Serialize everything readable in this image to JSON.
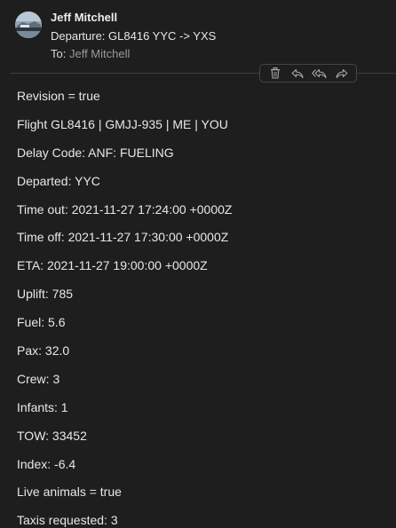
{
  "message": {
    "sender_name": "Jeff Mitchell",
    "subject": "Departure:  GL8416 YYC -> YXS",
    "to_label": "To:",
    "to_value": "Jeff Mitchell"
  },
  "toolbar": {
    "icons": [
      "trash-icon",
      "reply-icon",
      "reply-all-icon",
      "forward-icon"
    ]
  },
  "body_lines": [
    "Revision = true",
    "Flight GL8416 | GMJJ-935 | ME | YOU",
    "Delay Code: ANF: FUELING",
    "Departed: YYC",
    "Time out: 2021-11-27 17:24:00 +0000Z",
    "Time off: 2021-11-27 17:30:00 +0000Z",
    "ETA: 2021-11-27 19:00:00 +0000Z",
    "Uplift: 785",
    "Fuel: 5.6",
    "Pax: 32.0",
    "Crew: 3",
    "Infants: 1",
    "TOW: 33452",
    "Index: -6.4",
    "Live animals = true",
    "Taxis requested: 3"
  ],
  "colors": {
    "background": "#1e1e1e",
    "text": "#e8e8e8",
    "muted": "#9a9a9a"
  }
}
